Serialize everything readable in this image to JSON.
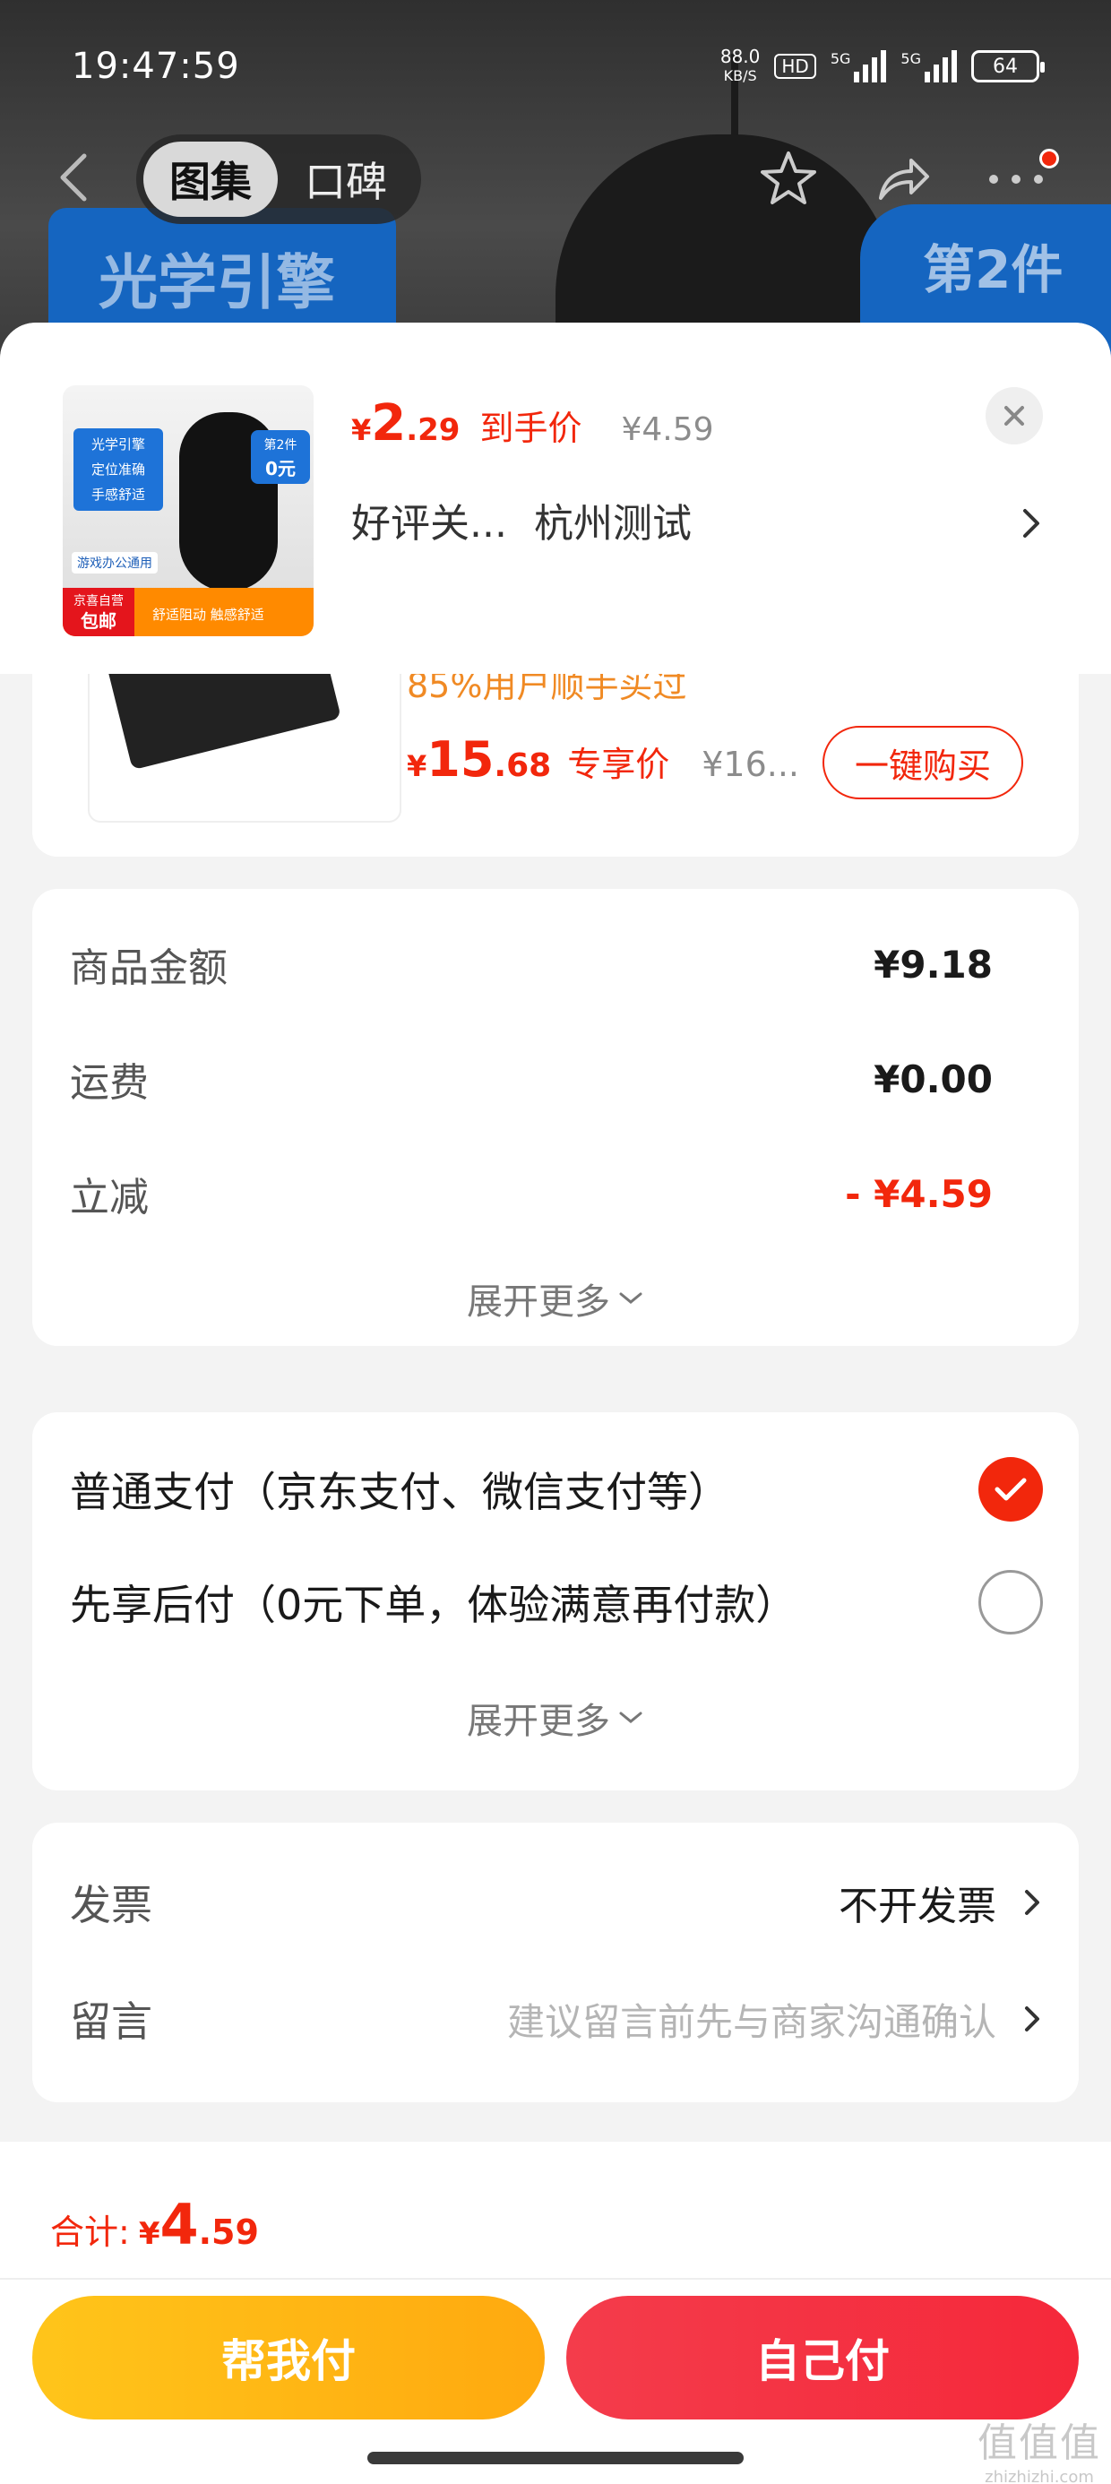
{
  "status_bar": {
    "time": "19:47:59",
    "net_speed": "88.0",
    "net_unit": "KB/S",
    "hd_label": "HD",
    "signal1_label": "5G",
    "signal2_label": "5G",
    "battery": "64"
  },
  "product_nav": {
    "tabs": [
      {
        "label": "图集",
        "active": true
      },
      {
        "label": "口碑",
        "active": false
      }
    ],
    "icons": [
      "back-icon",
      "star-icon",
      "share-icon",
      "more-icon"
    ]
  },
  "background_promo": {
    "left_text": "光学引擎",
    "right_text": "第2件"
  },
  "sheet_header": {
    "thumb": {
      "features": [
        "光学引擎",
        "定位准确",
        "手感舒适"
      ],
      "use": "游戏办公通用",
      "badge_top": "第2件",
      "badge_bottom": "0元",
      "jd_top": "京喜自营",
      "jd_bottom": "包邮",
      "slogan": "舒适阻动 触感舒适"
    },
    "price": {
      "yen": "¥",
      "int": "2",
      "dec": ".29"
    },
    "price_tag": "到手价",
    "original_price": "¥4.59",
    "title_text": "好评关...",
    "location": "杭州测试"
  },
  "recommend": {
    "sold_text": "85%用户顺手买过",
    "price": {
      "yen": "¥",
      "int": "15",
      "dec": ".68"
    },
    "price_tag": "专享价",
    "original_price": "¥16...",
    "buy_label": "一键购买"
  },
  "amounts": {
    "rows": [
      {
        "label": "商品金额",
        "value": "¥9.18"
      },
      {
        "label": "运费",
        "value": "¥0.00"
      },
      {
        "label": "立减",
        "value": "- ¥4.59"
      }
    ],
    "expand_label": "展开更多"
  },
  "payment": {
    "options": [
      {
        "label": "普通支付（京东支付、微信支付等）",
        "checked": true
      },
      {
        "label": "先享后付（0元下单，体验满意再付款）",
        "checked": false
      }
    ],
    "expand_label": "展开更多"
  },
  "invoice": {
    "invoice_label": "发票",
    "invoice_value": "不开发票",
    "message_label": "留言",
    "message_placeholder": "建议留言前先与商家沟通确认"
  },
  "bottom": {
    "total_label": "合计:",
    "total": {
      "yen": "¥",
      "int": "4",
      "dec": ".59"
    },
    "help_pay_label": "帮我付",
    "self_pay_label": "自己付"
  },
  "watermark": {
    "logo": "值值值",
    "domain": "zhizhizhi.com"
  },
  "colors": {
    "accent_red": "#f2270c",
    "help_button_yellow": "#ffb814",
    "self_button_red": "#f5283a",
    "recommend_orange": "#f08a24"
  }
}
